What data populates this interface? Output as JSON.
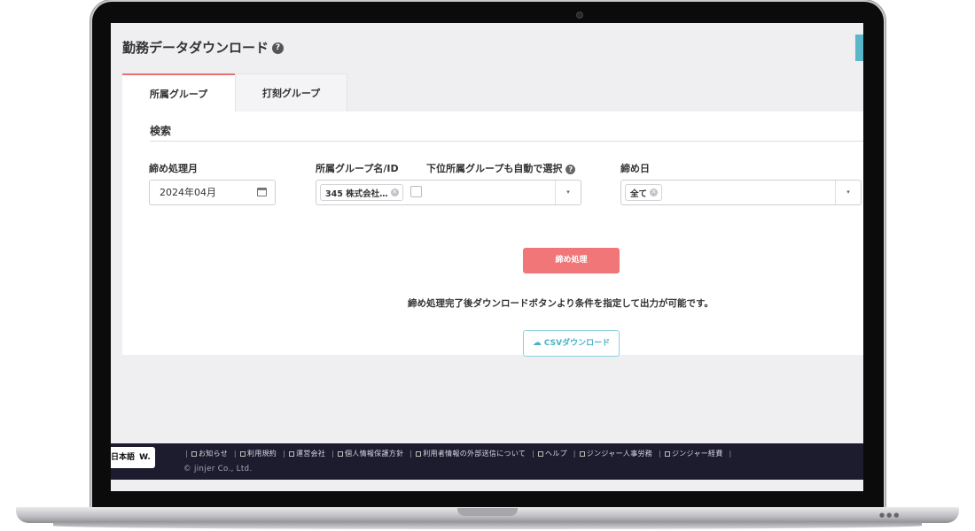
{
  "header": {
    "title": "勤務データダウンロード",
    "help_icon": "?"
  },
  "tabs": [
    {
      "label": "所属グループ",
      "active": true
    },
    {
      "label": "打刻グループ",
      "active": false
    }
  ],
  "search": {
    "title": "検索",
    "closing_month": {
      "label": "締め処理月",
      "value": "2024年04月"
    },
    "group": {
      "label": "所属グループ名/ID",
      "checkbox_label": "下位所属グループも自動で選択",
      "help_icon": "?",
      "chip": "345 株式会社…",
      "checked": false
    },
    "closing_day": {
      "label": "締め日",
      "chip": "全て"
    }
  },
  "actions": {
    "close_button": "締め処理",
    "info_text": "締め処理完了後ダウンロードボタンより条件を指定して出力が可能です。",
    "csv_button": "CSVダウンロード"
  },
  "footer": {
    "language": "日本語",
    "language_mark": "W.",
    "links": [
      "お知らせ",
      "利用規約",
      "運営会社",
      "個人情報保護方針",
      "利用者情報の外部送信について",
      "ヘルプ",
      "ジンジャー人事労務",
      "ジンジャー経費"
    ],
    "copyright": "© jinjer Co., Ltd."
  },
  "colors": {
    "accent_red": "#f07677",
    "accent_teal": "#4bb3c6",
    "footer_bg": "#1d1b2e"
  }
}
